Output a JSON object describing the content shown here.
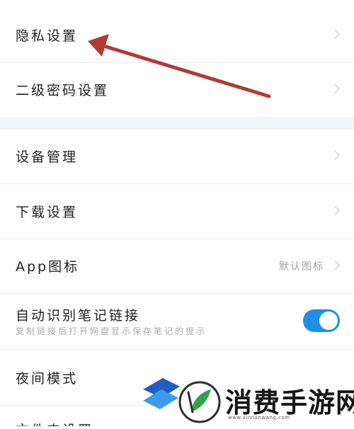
{
  "settings": {
    "group1": [
      {
        "label": "隐私设置"
      },
      {
        "label": "二级密码设置"
      }
    ],
    "group2": [
      {
        "label": "设备管理"
      },
      {
        "label": "下载设置"
      },
      {
        "label": "App图标",
        "value": "默认图标"
      },
      {
        "label": "自动识别笔记链接",
        "sublabel": "复制链接后打开网盘显示保存笔记的提示",
        "toggle_on": true
      },
      {
        "label": "夜间模式"
      },
      {
        "label": "文件夹设置"
      }
    ]
  },
  "colors": {
    "toggle_on": "#1e8fe8",
    "annotation_arrow": "#b03a35",
    "section_gap": "#f4f5f7"
  },
  "watermark": {
    "text": "消费手游网",
    "url": "www.xinnanwang.com"
  }
}
